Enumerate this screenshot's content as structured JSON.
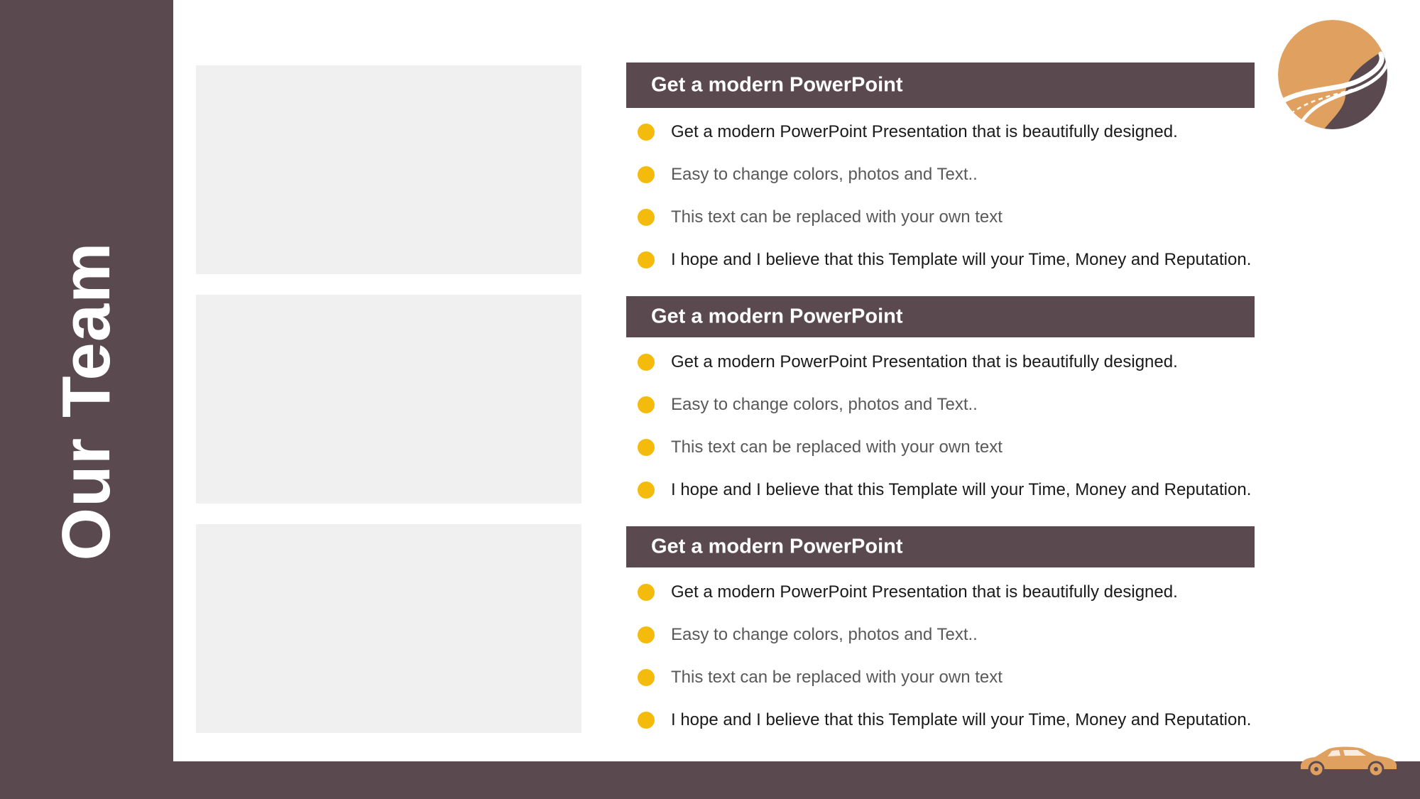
{
  "sidebar": {
    "title": "Our Team"
  },
  "sections": [
    {
      "header": "Get a modern PowerPoint",
      "bullets": [
        "Get a modern PowerPoint  Presentation that is beautifully designed.",
        "Easy to change colors, photos and Text..",
        "This text can be replaced with your own text",
        "I hope and I believe that this Template will your Time, Money and Reputation."
      ]
    },
    {
      "header": "Get a modern PowerPoint",
      "bullets": [
        "Get a modern PowerPoint  Presentation that is beautifully designed.",
        "Easy to change colors, photos and Text..",
        "This text can be replaced with your own text",
        "I hope and I believe that this Template will your Time, Money and Reputation."
      ]
    },
    {
      "header": "Get a modern PowerPoint",
      "bullets": [
        "Get a modern PowerPoint  Presentation that is beautifully designed.",
        "Easy to change colors, photos and Text..",
        "This text can be replaced with your own text",
        "I hope and I believe that this Template will your Time, Money and Reputation."
      ]
    }
  ],
  "icons": {
    "logo": "road-circle-logo-icon",
    "footer": "car-icon"
  },
  "colors": {
    "primary": "#5a4a4f",
    "accent_orange": "#e0a060",
    "bullet_yellow": "#f5bb0c",
    "placeholder_gray": "#f0f0f0"
  }
}
